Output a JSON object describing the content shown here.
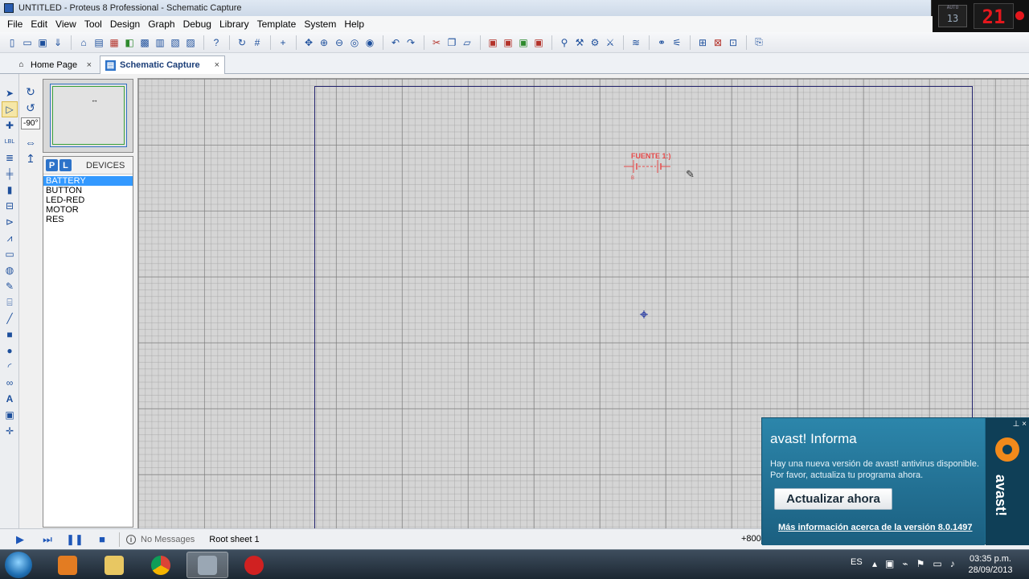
{
  "window": {
    "title": "UNTITLED - Proteus 8 Professional - Schematic Capture"
  },
  "overlay_clock": {
    "small_label": "AUTO",
    "small_value": "13",
    "big_value": "21"
  },
  "menu": [
    "File",
    "Edit",
    "View",
    "Tool",
    "Design",
    "Graph",
    "Debug",
    "Library",
    "Template",
    "System",
    "Help"
  ],
  "tabs": [
    {
      "label": "Home Page",
      "close": "×"
    },
    {
      "label": "Schematic Capture",
      "close": "×"
    }
  ],
  "rotation": {
    "angle_value": "-90°"
  },
  "devices": {
    "tab_p": "P",
    "tab_l": "L",
    "title": "DEVICES",
    "items": [
      "BATTERY",
      "BUTTON",
      "LED-RED",
      "MOTOR",
      "RES"
    ],
    "selected": "BATTERY"
  },
  "canvas": {
    "component_label": "FUENTE 1:)",
    "component_pin": "B"
  },
  "status": {
    "no_messages": "No Messages",
    "sheet": "Root sheet 1",
    "coord": "+800."
  },
  "avast": {
    "title": "avast! Informa",
    "body": "Hay una nueva versión de avast! antivirus disponible. Por favor, actualiza tu programa ahora.",
    "button": "Actualizar ahora",
    "link": "Más información acerca de la versión 8.0.1497",
    "brand": "avast!",
    "controls": "⊥ ×"
  },
  "taskbar": {
    "language": "ES",
    "time": "03:35 p.m.",
    "date": "28/09/2013"
  },
  "colors": {
    "accent": "#2d73c9",
    "selection": "#3399ff",
    "component_red": "#e64a4a",
    "avast_blue": "#1e6d8f"
  }
}
